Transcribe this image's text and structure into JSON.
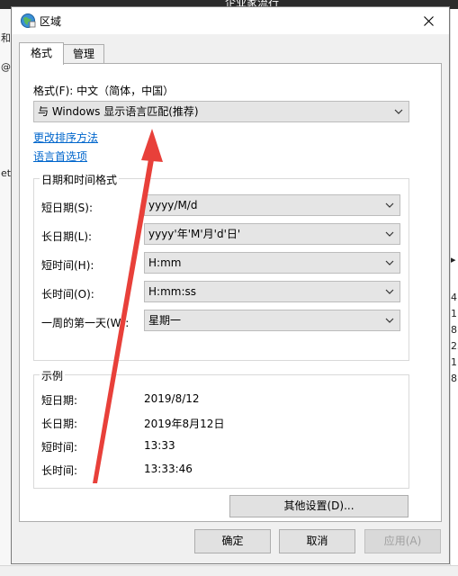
{
  "background": {
    "window_title": "企业家流行",
    "left_fragments": [
      "和",
      "et"
    ],
    "right_numbers": [
      "4",
      "1",
      "8",
      "25",
      "1",
      "8"
    ],
    "right_chevron": "chevron-right-icon"
  },
  "dialog": {
    "title": "区域",
    "close_icon": "close-icon",
    "tabs": [
      {
        "label": "格式"
      },
      {
        "label": "管理"
      }
    ],
    "format_label": "格式(F): 中文（简体，中国）",
    "format_value": "与 Windows 显示语言匹配(推荐)",
    "links": {
      "change_sort": "更改排序方法",
      "language_prefs": "语言首选项"
    },
    "datetime_group": {
      "title": "日期和时间格式",
      "rows": [
        {
          "label": "短日期(S):",
          "value": "yyyy/M/d"
        },
        {
          "label": "长日期(L):",
          "value": "yyyy'年'M'月'd'日'"
        },
        {
          "label": "短时间(H):",
          "value": "H:mm"
        },
        {
          "label": "长时间(O):",
          "value": "H:mm:ss"
        },
        {
          "label": "一周的第一天(W):",
          "value": "星期一"
        }
      ]
    },
    "example_group": {
      "title": "示例",
      "rows": [
        {
          "label": "短日期:",
          "value": "2019/8/12"
        },
        {
          "label": "长日期:",
          "value": "2019年8月12日"
        },
        {
          "label": "短时间:",
          "value": "13:33"
        },
        {
          "label": "长时间:",
          "value": "13:33:46"
        }
      ]
    },
    "other_settings_label": "其他设置(D)...",
    "buttons": {
      "ok": "确定",
      "cancel": "取消",
      "apply": "应用(A)"
    }
  },
  "colors": {
    "link": "#0066cc",
    "annotation_arrow": "#e8403a",
    "dialog_bg": "#f0f0f0"
  }
}
